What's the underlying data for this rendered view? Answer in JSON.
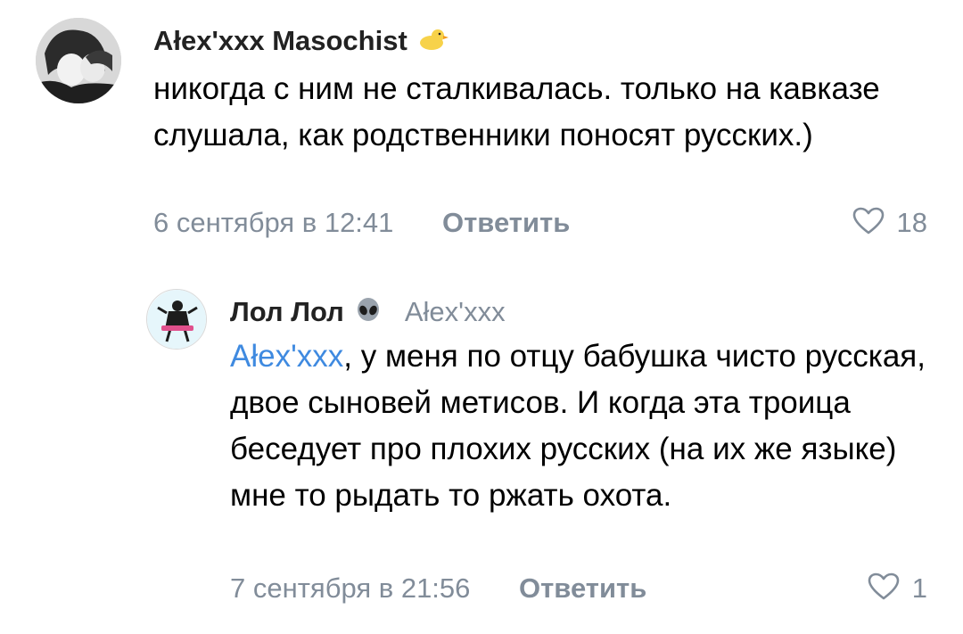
{
  "comments": [
    {
      "author": "Ałex'xxx Masochist",
      "author_badge_icon": "duck-emoji-icon",
      "text": "никогда с ним не сталкивалась. только на кавказе слушала, как родственники поносят русских.)",
      "date": "6 сентября в 12:41",
      "reply_label": "Ответить",
      "likes": "18"
    },
    {
      "author": "Лол Лол",
      "author_badge_icon": "alien-emoji-icon",
      "reply_to": "Ałex'xxx",
      "mention": "Ałex'xxx",
      "text": ", у меня по отцу бабушка чисто русская, двое сыновей метисов. И когда эта троица беседует про плохих русских (на их же языке) мне то рыдать то ржать охота.",
      "date": "7 сентября в 21:56",
      "reply_label": "Ответить",
      "likes": "1"
    }
  ],
  "colors": {
    "secondary_text": "#818c99",
    "mention": "#3f8ae0",
    "author": "#222222"
  }
}
